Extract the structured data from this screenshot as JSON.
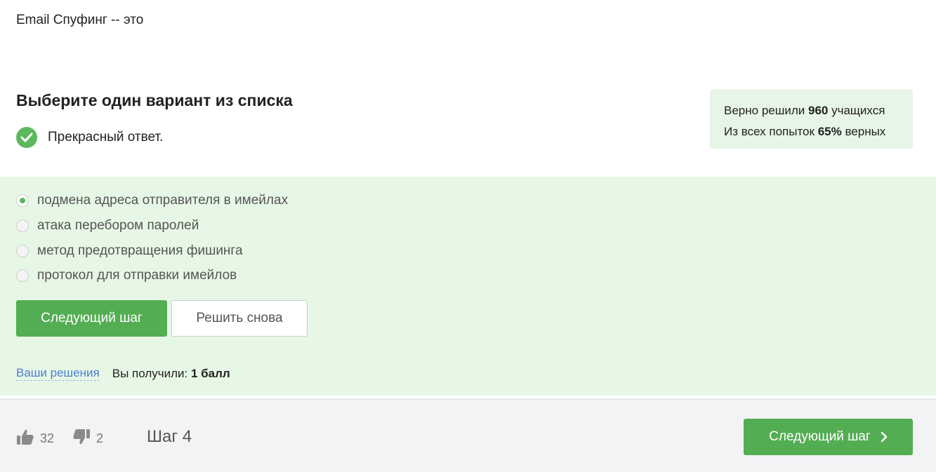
{
  "question": {
    "text": "Email Спуфинг -- это"
  },
  "task": {
    "title": "Выберите один вариант из списка",
    "feedback": "Прекрасный ответ."
  },
  "stats": {
    "line1_prefix": "Верно решили ",
    "line1_count": "960",
    "line1_suffix": " учащихся",
    "line2_prefix": "Из всех попыток ",
    "line2_percent": "65%",
    "line2_suffix": " верных"
  },
  "options": [
    {
      "label": "подмена адреса отправителя в имейлах",
      "selected": true
    },
    {
      "label": "атака перебором паролей",
      "selected": false
    },
    {
      "label": "метод предотвращения фишинга",
      "selected": false
    },
    {
      "label": "протокол для отправки имейлов",
      "selected": false
    }
  ],
  "actions": {
    "next_label": "Следующий шаг",
    "retry_label": "Решить снова"
  },
  "result": {
    "solutions_link": "Ваши решения",
    "score_prefix": "Вы получили: ",
    "score_value": "1 балл"
  },
  "footer": {
    "likes": "32",
    "dislikes": "2",
    "step": "Шаг 4",
    "next_label": "Следующий шаг"
  },
  "colors": {
    "accent": "#53ad53",
    "panel_bg": "#e7f7e6",
    "link": "#4a7fd4"
  },
  "icons": {
    "feedback": "check-circle-icon",
    "like": "thumbs-up-icon",
    "dislike": "thumbs-down-icon",
    "next": "chevron-right-icon"
  }
}
